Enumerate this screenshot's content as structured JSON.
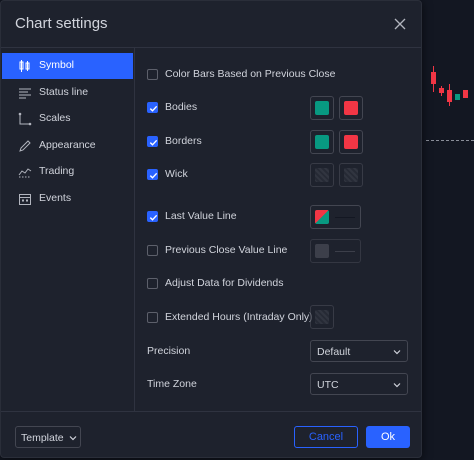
{
  "dialog": {
    "title": "Chart settings"
  },
  "sidebar": {
    "items": [
      {
        "label": "Symbol",
        "icon": "candles-icon",
        "active": true
      },
      {
        "label": "Status line",
        "icon": "status-line-icon",
        "active": false
      },
      {
        "label": "Scales",
        "icon": "scales-icon",
        "active": false
      },
      {
        "label": "Appearance",
        "icon": "pencil-icon",
        "active": false
      },
      {
        "label": "Trading",
        "icon": "trading-icon",
        "active": false
      },
      {
        "label": "Events",
        "icon": "calendar-icon",
        "active": false
      }
    ]
  },
  "symbol": {
    "color_bars": {
      "label": "Color Bars Based on Previous Close",
      "checked": false
    },
    "bodies": {
      "label": "Bodies",
      "checked": true,
      "up_color": "#089981",
      "down_color": "#f23645"
    },
    "borders": {
      "label": "Borders",
      "checked": true,
      "up_color": "#089981",
      "down_color": "#f23645"
    },
    "wick": {
      "label": "Wick",
      "checked": true
    },
    "last_value_line": {
      "label": "Last Value Line",
      "checked": true
    },
    "prev_close_line": {
      "label": "Previous Close Value Line",
      "checked": false
    },
    "adjust_dividends": {
      "label": "Adjust Data for Dividends",
      "checked": false
    },
    "extended_hours": {
      "label": "Extended Hours (Intraday Only)",
      "checked": false
    },
    "precision": {
      "label": "Precision",
      "value": "Default"
    },
    "timezone": {
      "label": "Time Zone",
      "value": "UTC"
    }
  },
  "footer": {
    "template_label": "Template",
    "cancel_label": "Cancel",
    "ok_label": "Ok"
  },
  "colors": {
    "accent": "#2962ff",
    "up": "#089981",
    "down": "#f23645"
  }
}
